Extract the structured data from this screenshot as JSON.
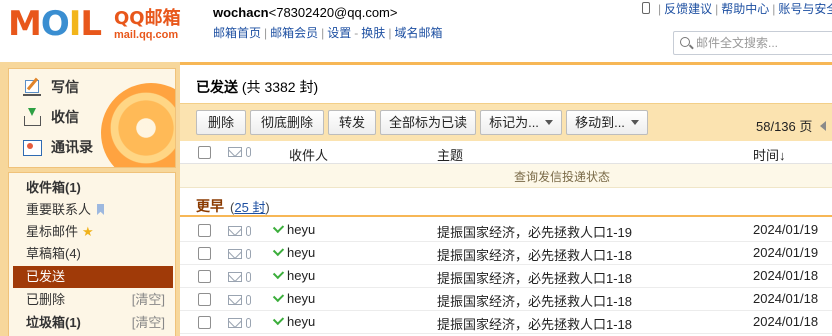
{
  "brand": {
    "logo_word": "MOIL",
    "name": "QQ邮箱",
    "url": "mail.qq.com"
  },
  "account": {
    "username": "wochacn",
    "email": "<78302420@qq.com>"
  },
  "topnav": [
    "邮箱首页",
    "邮箱会员",
    "设置",
    "换肤",
    "域名邮箱"
  ],
  "utilbar": [
    "反馈建议",
    "帮助中心",
    "账号与安全"
  ],
  "search": {
    "placeholder": "邮件全文搜索..."
  },
  "sidebar": {
    "quick": [
      {
        "label": "写信",
        "icon": "compose-icon"
      },
      {
        "label": "收信",
        "icon": "inbox-download-icon"
      },
      {
        "label": "通讯录",
        "icon": "contacts-icon"
      }
    ],
    "folders": [
      {
        "label": "收件箱(1)",
        "bold": true
      },
      {
        "label": "重要联系人",
        "icon": "bookmark-icon"
      },
      {
        "label": "星标邮件",
        "icon": "star-icon"
      },
      {
        "label": "草稿箱(4)"
      },
      {
        "label": "已发送",
        "active": true
      },
      {
        "label": "已删除",
        "clear": "[清空]"
      },
      {
        "label": "垃圾箱(1)",
        "bold": true,
        "clear": "[清空]"
      }
    ]
  },
  "main": {
    "title": "已发送",
    "subtitle": "(共 3382 封)",
    "toolbar": {
      "buttons": [
        "删除",
        "彻底删除",
        "转发",
        "全部标为已读"
      ],
      "dropdowns": [
        "标记为...",
        "移动到..."
      ]
    },
    "pager": "58/136 页",
    "columns": {
      "recipient": "收件人",
      "subject": "主题",
      "time": "时间↓"
    },
    "notice": "查询发信投递状态",
    "group": {
      "title": "更早",
      "count_open": "(",
      "count": "25 封",
      "count_close": ")"
    },
    "rows": [
      {
        "recipient": "heyu",
        "subject": "提振国家经济，必先拯救人口1-19",
        "time": "2024/01/19"
      },
      {
        "recipient": "heyu",
        "subject": "提振国家经济，必先拯救人口1-18",
        "time": "2024/01/19"
      },
      {
        "recipient": "heyu",
        "subject": "提振国家经济，必先拯救人口1-18",
        "time": "2024/01/18"
      },
      {
        "recipient": "heyu",
        "subject": "提振国家经济，必先拯救人口1-18",
        "time": "2024/01/18"
      },
      {
        "recipient": "heyu",
        "subject": "提振国家经济，必先拯救人口1-18",
        "time": "2024/01/18"
      }
    ]
  },
  "colors": {
    "brand_orange": "#e8571b",
    "sidebar_bg": "#f7d79b",
    "active_folder": "#a03a08",
    "toolbar_bg": "#fbe3b0",
    "link_blue": "#1e50a2"
  }
}
